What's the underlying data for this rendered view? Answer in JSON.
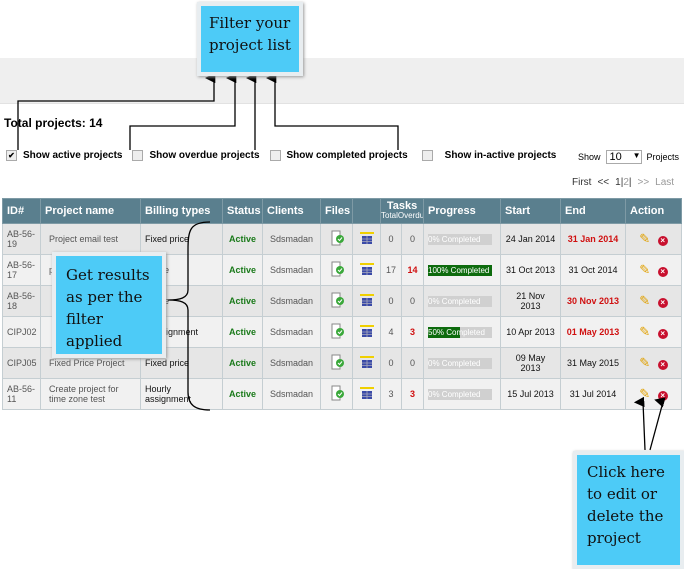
{
  "callouts": {
    "filter": "Filter your project list",
    "results": "Get results as per the filter applied",
    "action": "Click here to edit or delete the project"
  },
  "total": "Total projects: 14",
  "filters": [
    {
      "label": "Show active projects",
      "checked": true
    },
    {
      "label": "Show overdue projects",
      "checked": false
    },
    {
      "label": "Show completed projects",
      "checked": false
    },
    {
      "label": "Show in-active projects",
      "checked": false
    }
  ],
  "show": {
    "label": "Show",
    "value": "10",
    "suffix": "Projects"
  },
  "pager": {
    "first": "First",
    "prev": "<<",
    "p1": "1",
    "sep": "|",
    "p2": "2",
    "next": ">>",
    "last": "Last"
  },
  "headers": {
    "id": "ID#",
    "name": "Project name",
    "billing": "Billing types",
    "status": "Status",
    "clients": "Clients",
    "files": "Files",
    "tasks": "Tasks",
    "total": "Total",
    "overdue": "Overdue",
    "progress": "Progress",
    "start": "Start",
    "end": "End",
    "action": "Action"
  },
  "colors": {
    "header": "#5a7f8e",
    "callout": "#4dcbf7",
    "active": "#1a7a1a",
    "overdue": "#d01010",
    "progress": "#0d6b0d"
  },
  "rows": [
    {
      "id": "AB-56-19",
      "name": "Project email test",
      "billing": "Fixed price",
      "status": "Active",
      "client": "Sdsmadan",
      "total": "0",
      "overdue": "0",
      "progress": 0,
      "progress_label": "0% Completed",
      "start": "24 Jan 2014",
      "end": "31 Jan 2014",
      "end_overdue": true
    },
    {
      "id": "AB-56-17",
      "name": "p",
      "billing": "l price",
      "status": "Active",
      "client": "Sdsmadan",
      "total": "17",
      "overdue": "14",
      "progress": 100,
      "progress_label": "100% Completed",
      "start": "31 Oct 2013",
      "end": "31 Oct 2014",
      "end_overdue": false
    },
    {
      "id": "AB-56-18",
      "name": "",
      "billing": "l price",
      "status": "Active",
      "client": "Sdsmadan",
      "total": "0",
      "overdue": "0",
      "progress": 0,
      "progress_label": "0% Completed",
      "start": "21 Nov 2013",
      "end": "30 Nov 2013",
      "end_overdue": true
    },
    {
      "id": "CIPJ02",
      "name": "",
      "billing": "y assignment",
      "status": "Active",
      "client": "Sdsmadan",
      "total": "4",
      "overdue": "3",
      "progress": 50,
      "progress_label": "50% Completed",
      "start": "10 Apr 2013",
      "end": "01 May 2013",
      "end_overdue": true
    },
    {
      "id": "CIPJ05",
      "name": "Fixed Price Project",
      "billing": "Fixed price",
      "status": "Active",
      "client": "Sdsmadan",
      "total": "0",
      "overdue": "0",
      "progress": 0,
      "progress_label": "0% Completed",
      "start": "09 May 2013",
      "end": "31 May 2015",
      "end_overdue": false
    },
    {
      "id": "AB-56-11",
      "name": "Create project for time zone test",
      "billing": "Hourly assignment",
      "status": "Active",
      "client": "Sdsmadan",
      "total": "3",
      "overdue": "3",
      "progress": 0,
      "progress_label": "0% Completed",
      "start": "15 Jul 2013",
      "end": "31 Jul 2014",
      "end_overdue": false
    }
  ]
}
